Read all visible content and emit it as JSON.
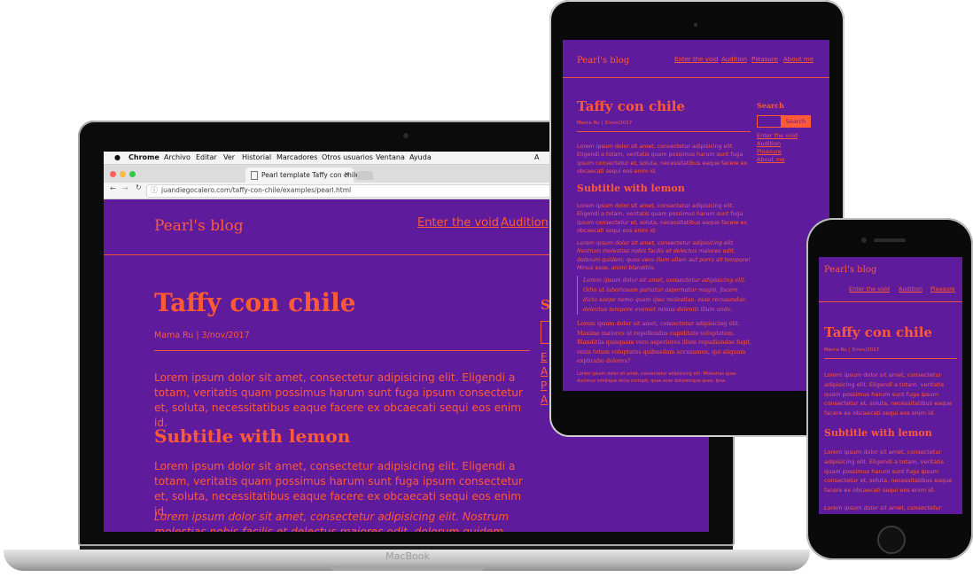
{
  "device_label": "MacBook",
  "browser": {
    "menubar": [
      "Chrome",
      "Archivo",
      "Editar",
      "Ver",
      "Historial",
      "Marcadores",
      "Otros usuarios",
      "Ventana",
      "Ayuda"
    ],
    "tab_title": "Pearl template Taffy con chile",
    "url": "juandiegocalero.com/taffy-con-chile/examples/pearl.html"
  },
  "site": {
    "brand": "Pearl's blog",
    "nav": [
      "Enter the void",
      "Audition",
      "Pleasure",
      "About me"
    ],
    "title": "Taffy con chile",
    "meta": "Mama Ru | 3/nov/2017",
    "para1": "Lorem ipsum dolor sit amet, consectetur adipisicing elit. Eligendi a totam, veritatis quam possimus harum sunt fuga ipsum consectetur et, soluta, necessitatibus eaque facere ex obcaecati sequi eos enim id.",
    "subtitle": "Subtitle with lemon",
    "para2": "Lorem ipsum dolor sit amet, consectetur adipisicing elit. Eligendi a totam, veritatis quam possimus harum sunt fuga ipsum consectetur et, soluta, necessitatibus eaque facere ex obcaecati sequi eos enim id.",
    "italic_para": "Lorem ipsum dolor sit amet, consectetur adipisicing elit. Nostrum molestias nobis facilis et delectus maiores odit, dolorum quidem, quos vero illum ullam aut porro sit tempore! Minus esse, animi blanditiis.",
    "quote": "Lorem ipsum dolor sit amet, consectetur adipisicing elit. Odio ut laboriosam pariatur aspernatur magni, facere dicta saepe nemo quam ipsa molestiae. esse recusandae, delectus tempore eveniet minus deleniti illum unde.",
    "serif_para": "Lorem ipsum dolor sit amet, consectetur adipisicing elit. Maxime maiores ut repellendus cupiditate voluptatem. Blanditiis quisquam vero asperiores illum repudiandae fugit, enim totam voluptates quibusdam accusamus, qui aliquam explicabo dolores?",
    "small_para": "Lorem ipsum dolor sit amet, consectetur adipisicing elit. Molestias quas ducimus similique dicta corrupti, quas esse doloremque quos. Ipsa",
    "sidebar": {
      "search_heading": "Search",
      "search_button": "Search",
      "search_heading_clipped": "S",
      "links_clipped": [
        "E",
        "A",
        "P",
        "A"
      ]
    }
  },
  "colors": {
    "background": "#5e1b9b",
    "accent": "#ff5a36"
  }
}
